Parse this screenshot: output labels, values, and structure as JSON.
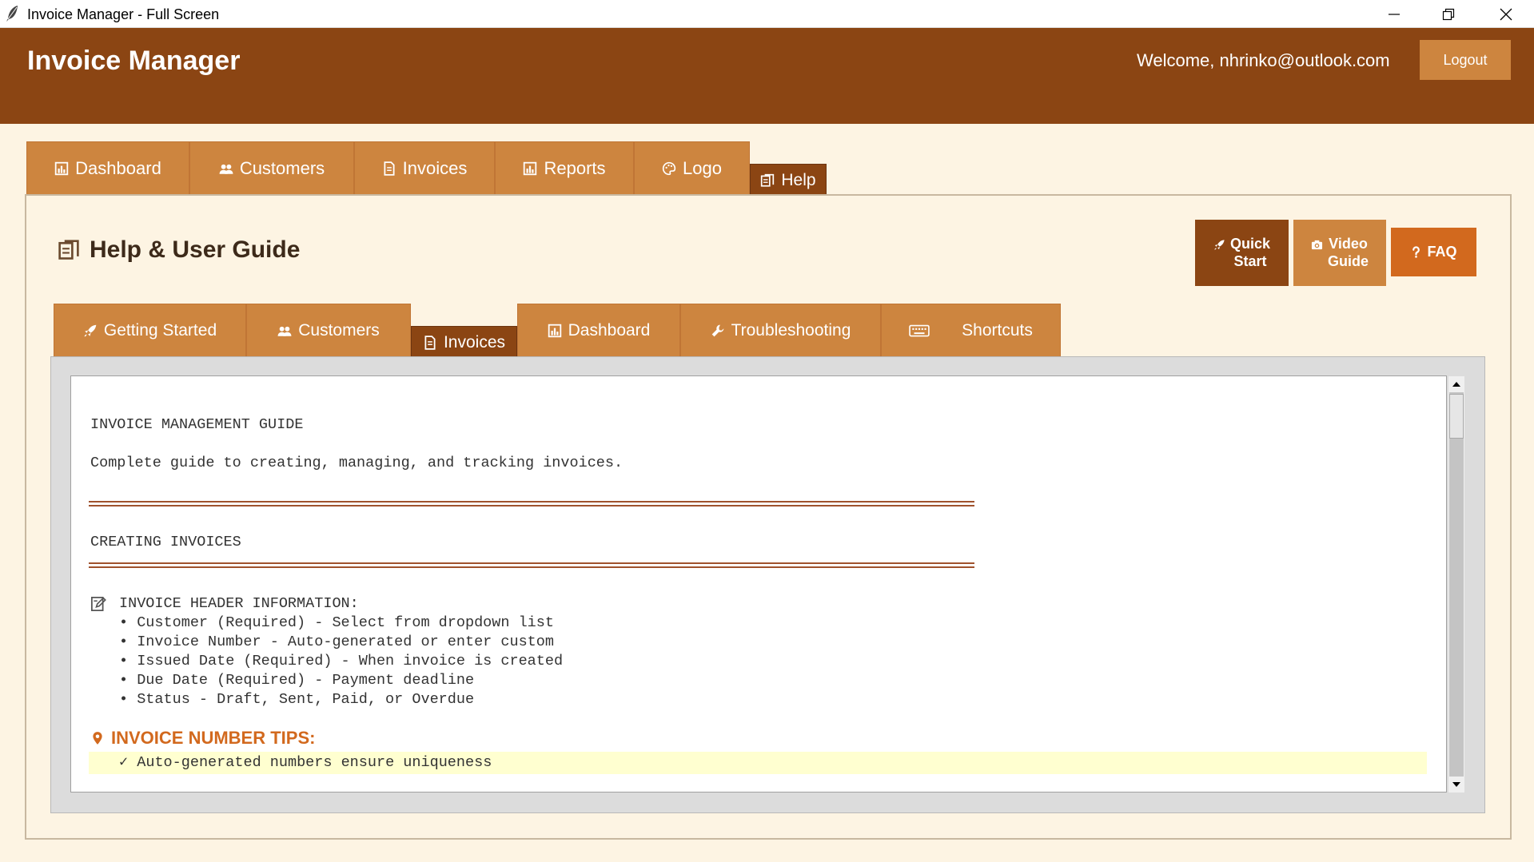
{
  "window": {
    "title": "Invoice Manager - Full Screen"
  },
  "header": {
    "app_title": "Invoice Manager",
    "welcome": "Welcome, nhrinko@outlook.com",
    "logout_label": "Logout"
  },
  "main_tabs": [
    {
      "label": "Dashboard",
      "icon": "bar-chart-icon"
    },
    {
      "label": "Customers",
      "icon": "users-icon"
    },
    {
      "label": "Invoices",
      "icon": "document-icon"
    },
    {
      "label": "Reports",
      "icon": "bar-chart-icon"
    },
    {
      "label": "Logo",
      "icon": "palette-icon"
    },
    {
      "label": "Help",
      "icon": "book-icon",
      "active": true
    }
  ],
  "help": {
    "title": "Help & User Guide",
    "actions": [
      {
        "label": "Quick\nStart",
        "icon": "rocket-icon"
      },
      {
        "label": "Video\nGuide",
        "icon": "camera-icon"
      },
      {
        "label": "FAQ",
        "icon": "question-icon"
      }
    ],
    "sub_tabs": [
      {
        "label": "Getting Started",
        "icon": "rocket-icon"
      },
      {
        "label": "Customers",
        "icon": "users-icon"
      },
      {
        "label": "Invoices",
        "icon": "document-icon",
        "active": true
      },
      {
        "label": "Dashboard",
        "icon": "bar-chart-icon"
      },
      {
        "label": "Troubleshooting",
        "icon": "wrench-icon"
      },
      {
        "label": "Shortcuts",
        "icon": "keyboard-icon"
      }
    ]
  },
  "guide": {
    "title": "INVOICE MANAGEMENT GUIDE",
    "intro": "Complete guide to creating, managing, and tracking invoices.",
    "section": "CREATING INVOICES",
    "header_info_title": "INVOICE HEADER INFORMATION:",
    "header_items": [
      "• Customer (Required) - Select from dropdown list",
      "• Invoice Number - Auto-generated or enter custom",
      "• Issued Date (Required) - When invoice is created",
      "• Due Date (Required) - Payment deadline",
      "• Status - Draft, Sent, Paid, or Overdue"
    ],
    "tips_title": "INVOICE NUMBER TIPS:",
    "tips_items": [
      "✓ Auto-generated numbers ensure uniqueness"
    ]
  },
  "colors": {
    "header_bg": "#8b4513",
    "tab_bg": "#cd853f",
    "tab_active_bg": "#8b4513",
    "page_bg": "#fdf4e3",
    "faq_bg": "#d2691e",
    "tips_title": "#d2691e",
    "highlight": "#ffffd0"
  }
}
